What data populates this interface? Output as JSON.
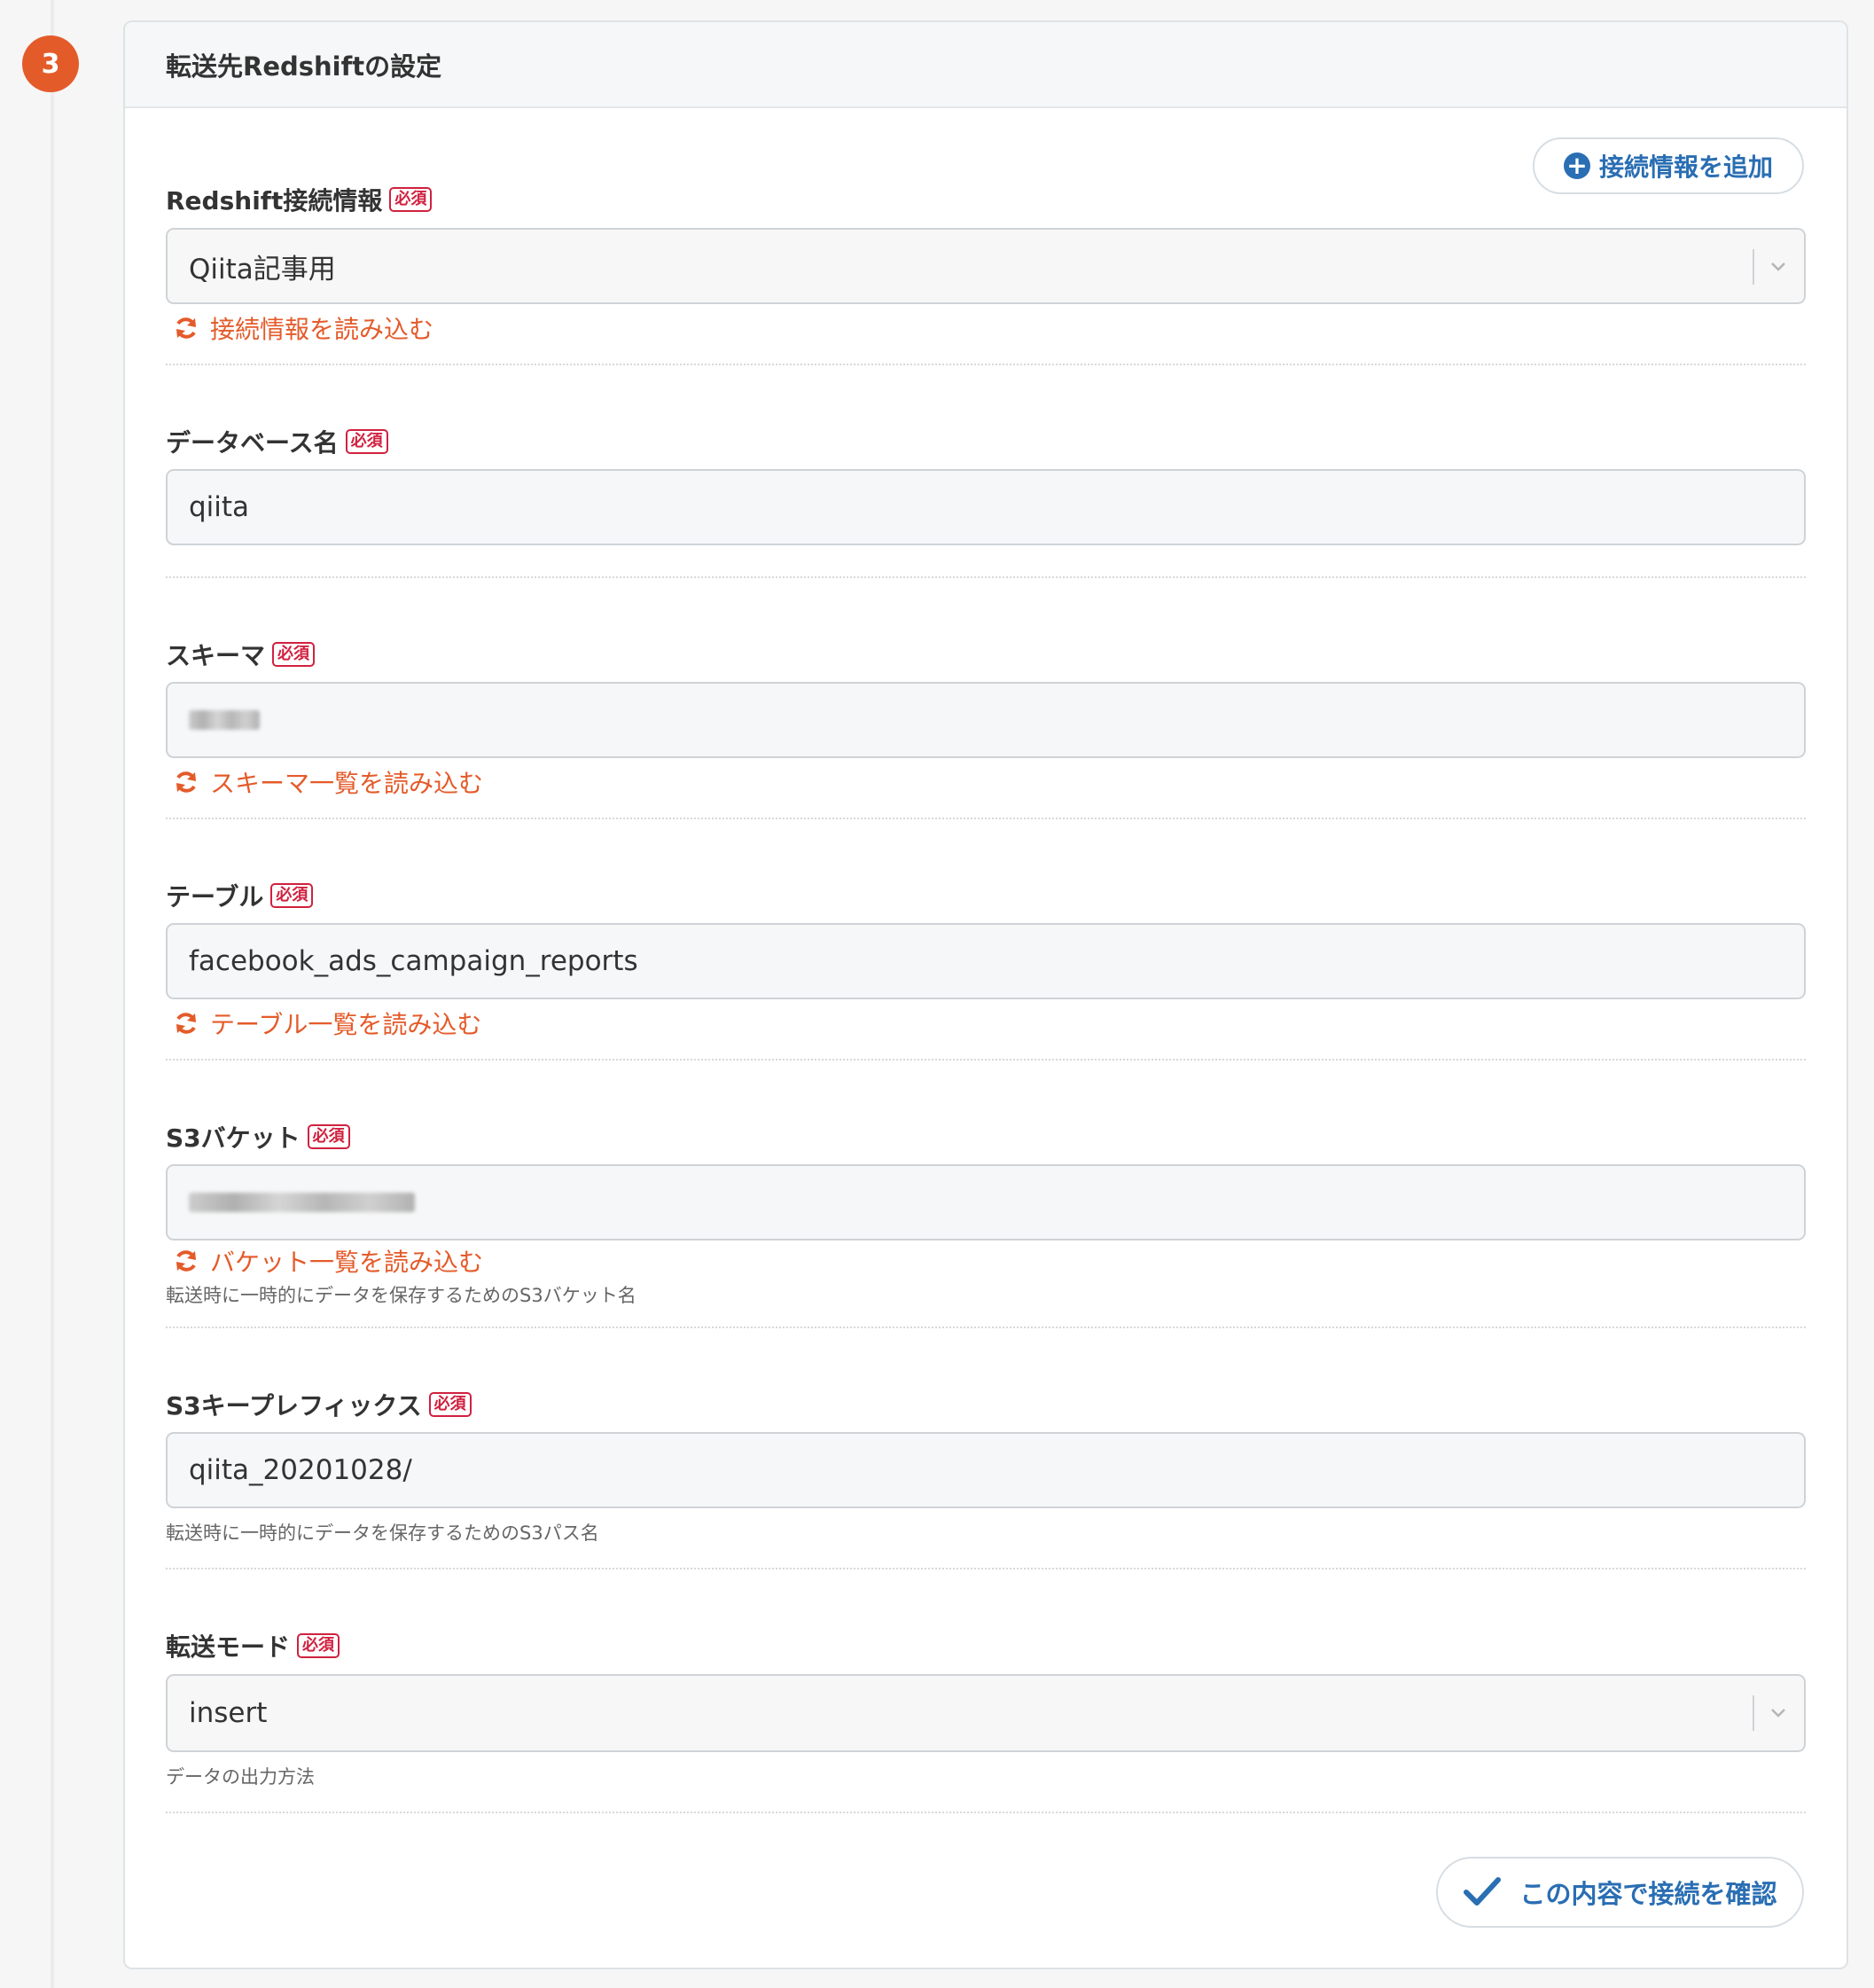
{
  "step": {
    "number": "3"
  },
  "card": {
    "title": "転送先Redshiftの設定"
  },
  "required_label": "必須",
  "add_connection_button": {
    "label": "接続情報を追加"
  },
  "fields": {
    "connection": {
      "label": "Redshift接続情報",
      "value": "Qiita記事用",
      "reload_label": "接続情報を読み込む"
    },
    "database": {
      "label": "データベース名",
      "value": "qiita"
    },
    "schema": {
      "label": "スキーマ",
      "value": "",
      "reload_label": "スキーマ一覧を読み込む"
    },
    "table": {
      "label": "テーブル",
      "value": "facebook_ads_campaign_reports",
      "reload_label": "テーブル一覧を読み込む"
    },
    "s3_bucket": {
      "label": "S3バケット",
      "value": "",
      "reload_label": "バケット一覧を読み込む",
      "hint": "転送時に一時的にデータを保存するためのS3バケット名"
    },
    "s3_key_prefix": {
      "label": "S3キープレフィックス",
      "value": "qiita_20201028/",
      "hint": "転送時に一時的にデータを保存するためのS3パス名"
    },
    "transfer_mode": {
      "label": "転送モード",
      "value": "insert",
      "hint": "データの出力方法"
    }
  },
  "confirm_button": {
    "label": "この内容で接続を確認"
  },
  "colors": {
    "accent_orange": "#e45b2a",
    "link_blue": "#2a6eb3",
    "required_red": "#d0213f"
  },
  "icons": {
    "reload": "reload-icon",
    "add": "plus-circle-icon",
    "confirm": "check-icon",
    "select": "chevron-down-icon"
  }
}
